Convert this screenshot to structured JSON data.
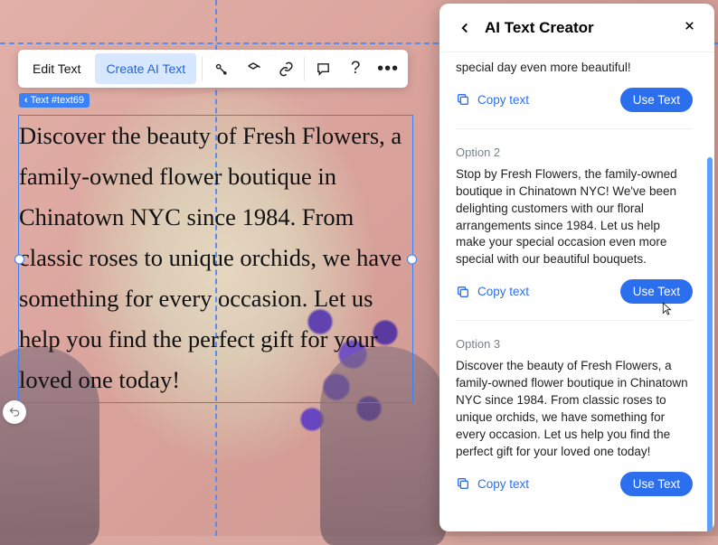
{
  "toolbar": {
    "edit_text": "Edit Text",
    "create_ai_text": "Create AI Text"
  },
  "element_badge": "Text #text69",
  "textbox_content": "Discover the beauty of Fresh Flowers, a family-owned flower boutique in Chinatown NYC since 1984. From classic roses to unique orchids, we have something for every occasion. Let us help you find the perfect gift for your loved one today!",
  "panel": {
    "title": "AI Text Creator",
    "copy_label": "Copy text",
    "use_label": "Use Text",
    "option1": {
      "label": ""
    },
    "option1_text": "special day even more beautiful!",
    "option2": {
      "label": "Option 2",
      "text": "Stop by Fresh Flowers, the family-owned boutique in Chinatown NYC! We've been delighting customers with our floral arrangements since 1984. Let us help make your special occasion even more special with our beautiful bouquets."
    },
    "option3": {
      "label": "Option 3",
      "text": "Discover the beauty of Fresh Flowers, a family-owned flower boutique in Chinatown NYC since 1984. From classic roses to unique orchids, we have something for every occasion. Let us help you find the perfect gift for your loved one today!"
    }
  }
}
